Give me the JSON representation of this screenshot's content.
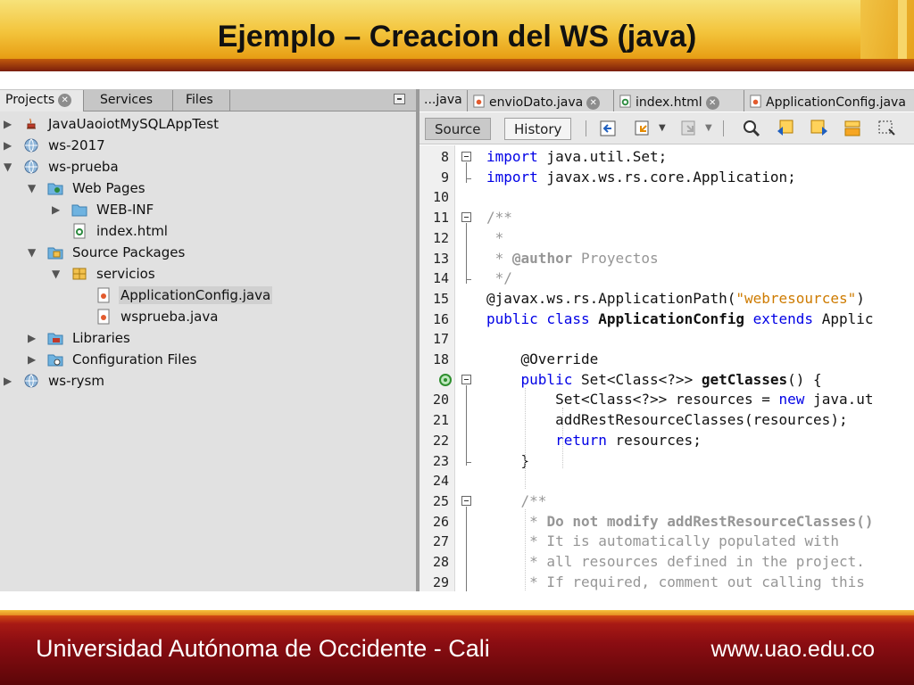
{
  "slide": {
    "title": "Ejemplo – Creacion del WS (java)",
    "footer_left": "Universidad Autónoma de Occidente - Cali",
    "footer_right": "www.uao.edu.co"
  },
  "left_panel": {
    "tabs": [
      {
        "label": "Projects",
        "active": true,
        "closable": true
      },
      {
        "label": "Services",
        "active": false,
        "closable": false
      },
      {
        "label": "Files",
        "active": false,
        "closable": false
      }
    ],
    "tree": [
      {
        "label": "JavaUaoiotMySQLAppTest",
        "icon": "java-project-icon",
        "expanded": false
      },
      {
        "label": "ws-2017",
        "icon": "web-project-icon",
        "expanded": false
      },
      {
        "label": "ws-prueba",
        "icon": "web-project-icon",
        "expanded": true
      },
      {
        "label": "Web Pages",
        "icon": "web-pages-folder-icon",
        "expanded": true
      },
      {
        "label": "WEB-INF",
        "icon": "folder-icon",
        "expanded": false
      },
      {
        "label": "index.html",
        "icon": "html-file-icon"
      },
      {
        "label": "Source Packages",
        "icon": "source-packages-icon",
        "expanded": true
      },
      {
        "label": "servicios",
        "icon": "package-icon",
        "expanded": true
      },
      {
        "label": "ApplicationConfig.java",
        "icon": "java-file-icon",
        "selected": true
      },
      {
        "label": "wsprueba.java",
        "icon": "java-file-icon"
      },
      {
        "label": "Libraries",
        "icon": "libraries-icon",
        "expanded": false
      },
      {
        "label": "Configuration Files",
        "icon": "config-files-icon",
        "expanded": false
      },
      {
        "label": "ws-rysm",
        "icon": "web-project-icon",
        "expanded": false
      }
    ]
  },
  "editor": {
    "tabs": [
      {
        "label": "...java",
        "icon": ""
      },
      {
        "label": "envioDato.java",
        "icon": "java-file-icon"
      },
      {
        "label": "index.html",
        "icon": "html-file-icon"
      },
      {
        "label": "ApplicationConfig.java",
        "icon": "java-file-icon"
      }
    ],
    "toolbar": {
      "source_label": "Source",
      "history_label": "History"
    },
    "lines": [
      {
        "n": "8",
        "t": [
          {
            "c": "kw",
            "s": "import"
          },
          {
            "c": "",
            "s": " java.util.Set;"
          }
        ]
      },
      {
        "n": "9",
        "t": [
          {
            "c": "kw",
            "s": "import"
          },
          {
            "c": "",
            "s": " javax.ws.rs.core.Application;"
          }
        ]
      },
      {
        "n": "10",
        "t": []
      },
      {
        "n": "11",
        "t": [
          {
            "c": "cm",
            "s": "/**"
          }
        ]
      },
      {
        "n": "12",
        "t": [
          {
            "c": "cm",
            "s": " *"
          }
        ]
      },
      {
        "n": "13",
        "t": [
          {
            "c": "cm",
            "s": " * "
          },
          {
            "c": "cmb",
            "s": "@author"
          },
          {
            "c": "cm",
            "s": " Proyectos"
          }
        ]
      },
      {
        "n": "14",
        "t": [
          {
            "c": "cm",
            "s": " */"
          }
        ]
      },
      {
        "n": "15",
        "t": [
          {
            "c": "",
            "s": "@javax.ws.rs.ApplicationPath("
          },
          {
            "c": "str",
            "s": "\"webresources\""
          },
          {
            "c": "",
            "s": ")"
          }
        ]
      },
      {
        "n": "16",
        "t": [
          {
            "c": "kw",
            "s": "public class "
          },
          {
            "c": "bold",
            "s": "ApplicationConfig"
          },
          {
            "c": "kw",
            "s": " extends "
          },
          {
            "c": "",
            "s": "Applic"
          }
        ]
      },
      {
        "n": "17",
        "t": []
      },
      {
        "n": "18",
        "t": [
          {
            "c": "",
            "s": "    @Override"
          }
        ]
      },
      {
        "n": "",
        "t": [
          {
            "c": "kw",
            "s": "    public "
          },
          {
            "c": "",
            "s": "Set<Class<?>> "
          },
          {
            "c": "bold",
            "s": "getClasses"
          },
          {
            "c": "",
            "s": "() {"
          }
        ]
      },
      {
        "n": "20",
        "t": [
          {
            "c": "",
            "s": "        Set<Class<?>> resources = "
          },
          {
            "c": "kw",
            "s": "new"
          },
          {
            "c": "",
            "s": " java.ut"
          }
        ]
      },
      {
        "n": "21",
        "t": [
          {
            "c": "",
            "s": "        addRestResourceClasses(resources);"
          }
        ]
      },
      {
        "n": "22",
        "t": [
          {
            "c": "kw",
            "s": "        return"
          },
          {
            "c": "",
            "s": " resources;"
          }
        ]
      },
      {
        "n": "23",
        "t": [
          {
            "c": "",
            "s": "    }"
          }
        ]
      },
      {
        "n": "24",
        "t": []
      },
      {
        "n": "25",
        "t": [
          {
            "c": "cm",
            "s": "    /**"
          }
        ]
      },
      {
        "n": "26",
        "t": [
          {
            "c": "cm",
            "s": "     * "
          },
          {
            "c": "cmb",
            "s": "Do not modify addRestResourceClasses()"
          }
        ]
      },
      {
        "n": "27",
        "t": [
          {
            "c": "cm",
            "s": "     * It is automatically populated with"
          }
        ]
      },
      {
        "n": "28",
        "t": [
          {
            "c": "cm",
            "s": "     * all resources defined in the project."
          }
        ]
      },
      {
        "n": "29",
        "t": [
          {
            "c": "cm",
            "s": "     * If required, comment out calling this"
          }
        ]
      }
    ]
  }
}
